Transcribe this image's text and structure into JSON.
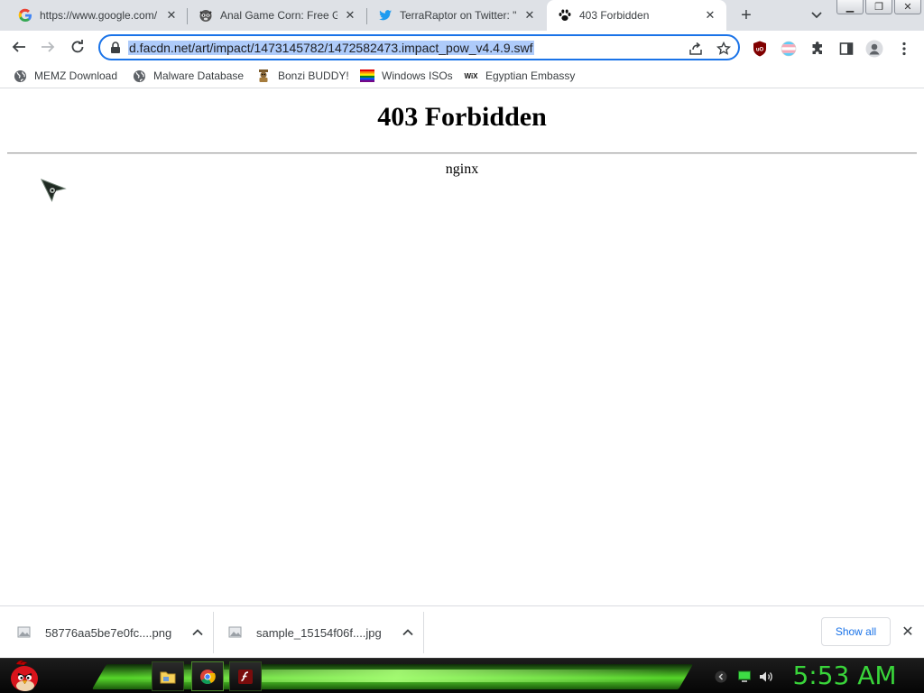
{
  "browser": {
    "tabs": [
      {
        "title": "https://www.google.com/",
        "favicon": "google-g-icon",
        "active": false
      },
      {
        "title": "Anal Game Corn: Free Ga",
        "favicon": "raccoon-icon",
        "active": false
      },
      {
        "title": "TerraRaptor on Twitter: \"I",
        "favicon": "twitter-bird-icon",
        "active": false
      },
      {
        "title": "403 Forbidden",
        "favicon": "paw-icon",
        "active": true
      }
    ],
    "new_tab_label": "+",
    "url": "d.facdn.net/art/impact/1473145782/1472582473.impact_pow_v4.4.9.swf",
    "bookmarks": [
      {
        "label": "MEMZ Download",
        "icon": "globe-icon"
      },
      {
        "label": "Malware Database",
        "icon": "globe-icon"
      },
      {
        "label": "Bonzi BUDDY!",
        "icon": "bonzi-icon"
      },
      {
        "label": "Windows ISOs",
        "icon": "rainbow-flag-icon"
      },
      {
        "label": "Egyptian Embassy",
        "icon": "wix-icon"
      }
    ],
    "extensions": [
      "ublock-icon",
      "trans-flag-icon",
      "puzzle-icon",
      "sidepanel-icon",
      "profile-icon",
      "menu-icon"
    ]
  },
  "page": {
    "heading": "403 Forbidden",
    "server": "nginx"
  },
  "downloads": {
    "items": [
      {
        "filename": "58776aa5be7e0fc....png"
      },
      {
        "filename": "sample_15154f06f....jpg"
      }
    ],
    "show_all_label": "Show all"
  },
  "taskbar": {
    "clock": "5:53 AM",
    "pinned": [
      "file-explorer-icon",
      "chrome-icon",
      "flash-player-icon"
    ],
    "tray": [
      "chevron-icon",
      "network-icon",
      "volume-icon"
    ]
  },
  "colors": {
    "accent": "#1a73e8",
    "url_highlight": "#aecbfa",
    "clock": "#39d43a",
    "taskbar_green": "#56d62a"
  }
}
